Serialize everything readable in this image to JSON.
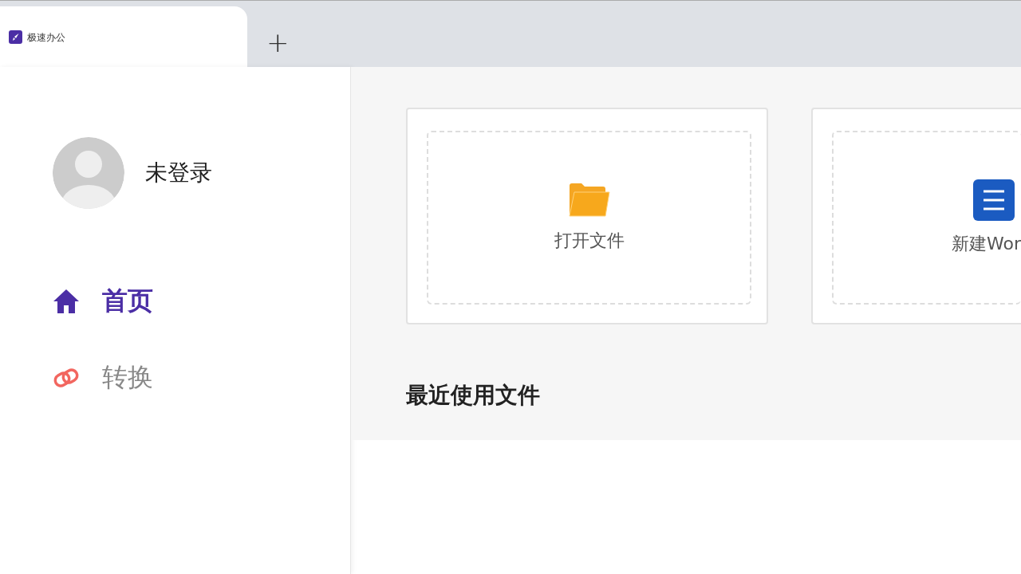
{
  "tab": {
    "title": "极速办公",
    "new_tab": "+"
  },
  "user": {
    "name": "未登录"
  },
  "nav": [
    {
      "kind": "home",
      "label": "首页",
      "selected": true
    },
    {
      "kind": "convert",
      "label": "转换",
      "selected": false
    }
  ],
  "actions": [
    {
      "kind": "open",
      "label": "打开文件"
    },
    {
      "kind": "word",
      "label": "新建Wor"
    }
  ],
  "recent": {
    "title": "最近使用文件"
  }
}
